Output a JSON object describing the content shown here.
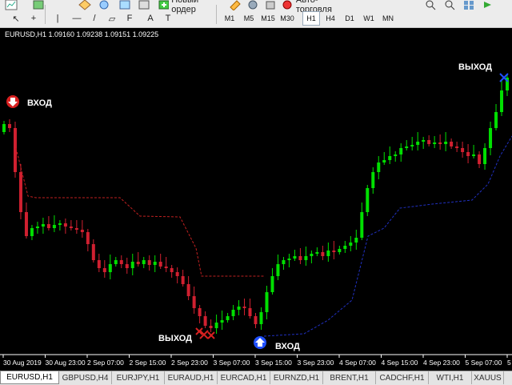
{
  "toolbar": {
    "new_order_label": "Новый ордер",
    "autotrading_label": "Авто-торговля",
    "timeframes": [
      "M1",
      "M5",
      "M15",
      "M30",
      "H1",
      "H4",
      "D1",
      "W1",
      "MN"
    ],
    "active_timeframe": "H1",
    "tools": [
      "cursor-icon",
      "crosshair-icon",
      "vertical-line-icon",
      "horizontal-line-icon",
      "trendline-icon",
      "channel-icon",
      "fibonacci-icon",
      "text-icon",
      "label-icon"
    ]
  },
  "chart_header": "EURUSD,H1  1.09160 1.09238 1.09151 1.09225",
  "x_axis_labels": [
    "30 Aug 2019",
    "30 Aug 23:00",
    "2 Sep 07:00",
    "2 Sep 15:00",
    "2 Sep 23:00",
    "3 Sep 07:00",
    "3 Sep 15:00",
    "3 Sep 23:00",
    "4 Sep 07:00",
    "4 Sep 15:00",
    "4 Sep 23:00",
    "5 Sep 07:00",
    "5 Sep 15:00",
    "5"
  ],
  "signals": [
    {
      "type": "entry-sell",
      "label": "ВХОД"
    },
    {
      "type": "exit",
      "label": "ВЫХОД"
    },
    {
      "type": "entry-buy",
      "label": "ВХОД"
    },
    {
      "type": "exit",
      "label": "ВЫХОД"
    }
  ],
  "colors": {
    "bull": "#00e000",
    "bear": "#d02030",
    "background": "#000000",
    "sell_trail": "#c02020",
    "buy_trail": "#2030c0"
  },
  "tabs": [
    {
      "label": "EURUSD,H1",
      "active": true
    },
    {
      "label": "GBPUSD,H4"
    },
    {
      "label": "EURJPY,H1"
    },
    {
      "label": "EURAUD,H1"
    },
    {
      "label": "EURCAD,H1"
    },
    {
      "label": "EURNZD,H1"
    },
    {
      "label": "BRENT,H1"
    },
    {
      "label": "CADCHF,H1"
    },
    {
      "label": "WTI,H1"
    },
    {
      "label": "XAUUS"
    }
  ]
}
